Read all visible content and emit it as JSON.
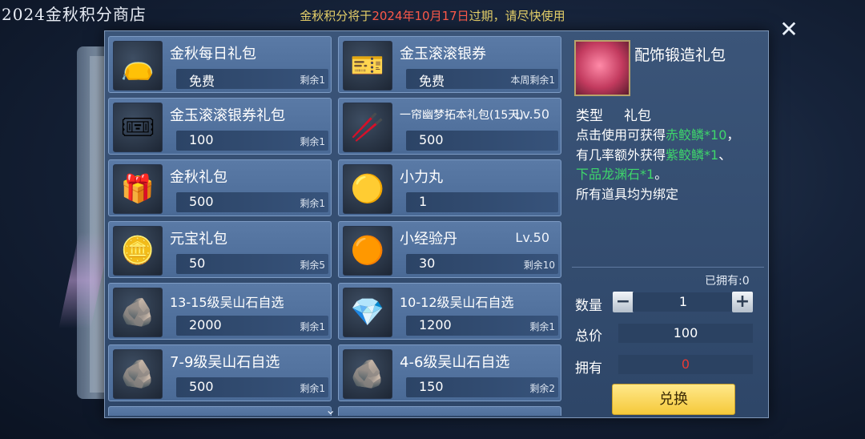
{
  "header": {
    "shop_title": "2024金秋积分商店",
    "notice_prefix": "金秋积分将于",
    "notice_date": "2024年10月17日",
    "notice_suffix": "过期，请尽快使用"
  },
  "items": [
    {
      "name": "金秋每日礼包",
      "price": "免费",
      "remain": "剩余1",
      "lv": "",
      "icon": "bag-icon"
    },
    {
      "name": "金玉滚滚银券",
      "price": "免费",
      "remain": "本周剩余1",
      "lv": "",
      "icon": "silver-ticket-icon"
    },
    {
      "name": "金玉滚滚银券礼包",
      "price": "100",
      "remain": "剩余1",
      "lv": "",
      "icon": "silver-ticket-pack-icon"
    },
    {
      "name": "一帘幽梦拓本礼包(15天)",
      "price": "500",
      "remain": "",
      "lv": "Lv.50",
      "icon": "hairpin-icon"
    },
    {
      "name": "金秋礼包",
      "price": "500",
      "remain": "剩余1",
      "lv": "",
      "icon": "gift-box-icon"
    },
    {
      "name": "小力丸",
      "price": "1",
      "remain": "",
      "lv": "",
      "icon": "pill-icon"
    },
    {
      "name": "元宝礼包",
      "price": "50",
      "remain": "剩余5",
      "lv": "",
      "icon": "ingot-icon"
    },
    {
      "name": "小经验丹",
      "price": "30",
      "remain": "剩余10",
      "lv": "Lv.50",
      "icon": "exp-pills-icon"
    },
    {
      "name": "13-15级吴山石自选",
      "price": "2000",
      "remain": "剩余1",
      "lv": "",
      "icon": "dark-stone-icon"
    },
    {
      "name": "10-12级吴山石自选",
      "price": "1200",
      "remain": "剩余1",
      "lv": "",
      "icon": "blue-stone-icon"
    },
    {
      "name": "7-9级吴山石自选",
      "price": "500",
      "remain": "剩余1",
      "lv": "",
      "icon": "gray-stone-icon"
    },
    {
      "name": "4-6级吴山石自选",
      "price": "150",
      "remain": "剩余2",
      "lv": "",
      "icon": "green-stone-icon"
    }
  ],
  "detail": {
    "name": "配饰锻造礼包",
    "type_label": "类型",
    "type_value": "礼包",
    "desc_1": "点击使用可获得",
    "desc_1g": "赤鲛鳞*10",
    "desc_1e": "，",
    "desc_2": "有几率额外获得",
    "desc_2g": "紫鲛鳞*1",
    "desc_2e": "、",
    "desc_3g": "下品龙渊石*1",
    "desc_3e": "。",
    "desc_4": "所有道具均为绑定",
    "owned": "已拥有:0",
    "qty_label": "数量",
    "qty_value": "1",
    "minus": "−",
    "plus": "+",
    "total_label": "总价",
    "total_value": "100",
    "have_label": "拥有",
    "have_value": "0",
    "exchange": "兑换"
  },
  "colors": {
    "accent_gold": "#f5c93a",
    "notice_red": "#ff5a4a",
    "green_text": "#3ed66b"
  }
}
